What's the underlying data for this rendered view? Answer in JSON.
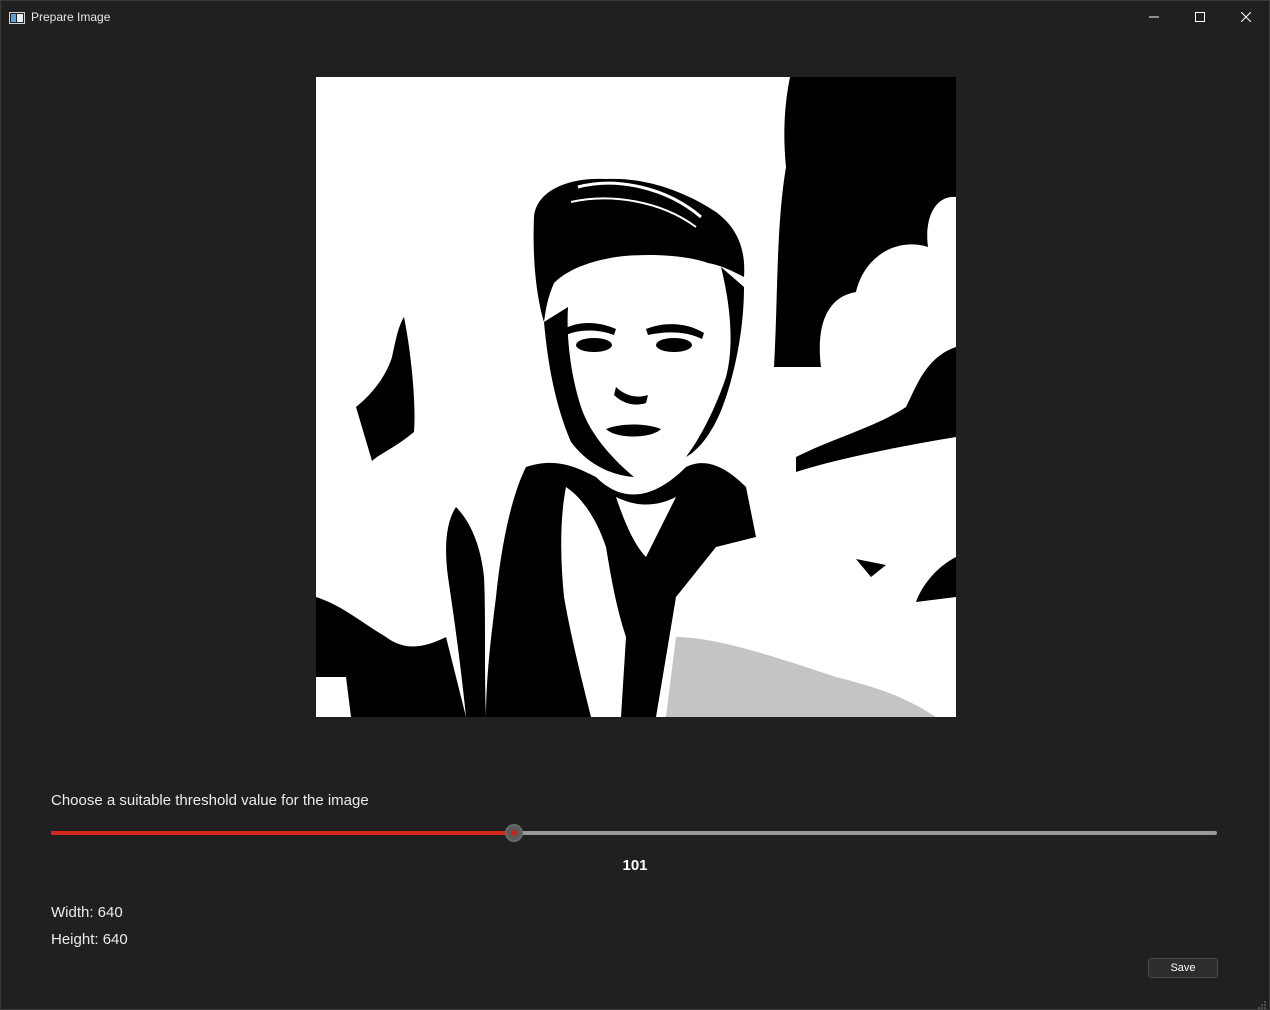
{
  "window": {
    "title": "Prepare Image",
    "controls": [
      "minimize-icon",
      "maximize-icon",
      "close-icon"
    ]
  },
  "image": {
    "description_icon": "image-preview",
    "style": "black-and-white threshold"
  },
  "threshold": {
    "label": "Choose a suitable threshold value for the image",
    "value": "101",
    "level": 101,
    "min": 0,
    "max": 255,
    "fill_color": "#d4271e",
    "track_color": "#9a9a9a"
  },
  "info": {
    "width_text": "Width: 640",
    "height_text": "Height: 640"
  },
  "actions": {
    "save_label": "Save"
  }
}
